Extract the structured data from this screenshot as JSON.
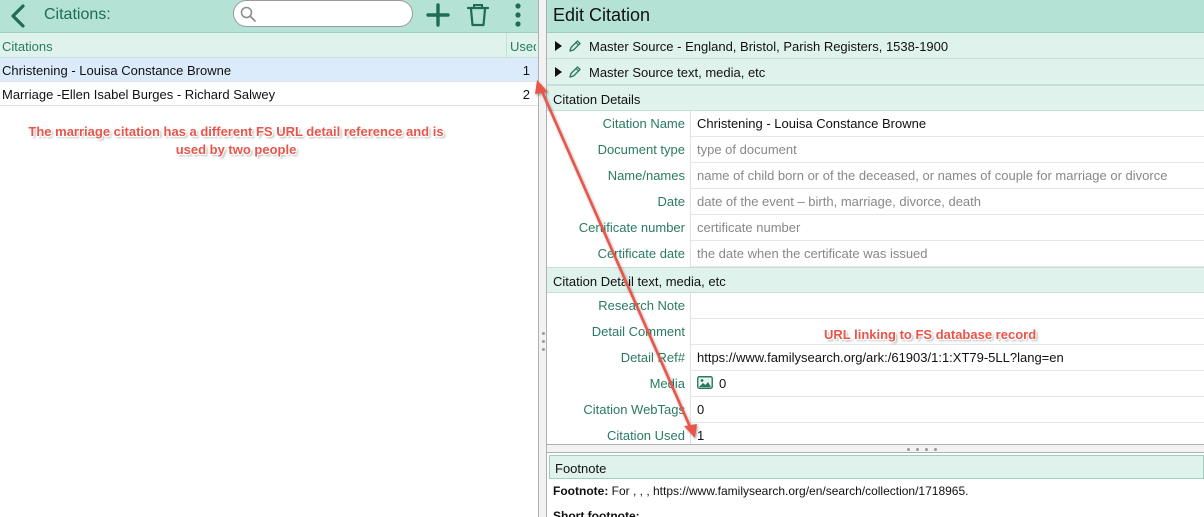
{
  "left": {
    "title": "Citations:",
    "search": {
      "value": "",
      "placeholder": ""
    },
    "columns": {
      "name": "Citations",
      "used": "Used"
    },
    "rows": [
      {
        "name": "Christening - Louisa Constance Browne",
        "used": "1"
      },
      {
        "name": "Marriage -Ellen Isabel Burges - Richard Salwey",
        "used": "2"
      }
    ],
    "annotation": "The marriage citation has a different FS URL detail reference and is used by two people"
  },
  "right": {
    "title": "Edit Citation",
    "master_source": "Master Source - England, Bristol, Parish Registers, 1538-1900",
    "master_source_text": "Master Source text, media, etc",
    "citation_details_header": "Citation Details",
    "fields": {
      "citation_name": {
        "label": "Citation Name",
        "value": "Christening - Louisa Constance Browne"
      },
      "document_type": {
        "label": "Document type",
        "placeholder": "type of document"
      },
      "names": {
        "label": "Name/names",
        "placeholder": "name of child born or of the deceased, or names of couple for marriage or divorce"
      },
      "date": {
        "label": "Date",
        "placeholder": "date of the event – birth, marriage, divorce, death"
      },
      "certificate_number": {
        "label": "Certificate number",
        "placeholder": "certificate number"
      },
      "certificate_date": {
        "label": "Certificate date",
        "placeholder": "the date when the certificate was issued"
      }
    },
    "detail_header": "Citation Detail text, media, etc",
    "detail_fields": {
      "research_note": {
        "label": "Research Note",
        "value": ""
      },
      "detail_comment": {
        "label": "Detail Comment",
        "value": ""
      },
      "detail_ref": {
        "label": "Detail Ref#",
        "value": "https://www.familysearch.org/ark:/61903/1:1:XT79-5LL?lang=en"
      },
      "media": {
        "label": "Media",
        "value": "0"
      },
      "webtags": {
        "label": "Citation WebTags",
        "value": "0"
      },
      "citation_used": {
        "label": "Citation Used",
        "value": "1"
      }
    },
    "url_annotation": "URL linking to FS database record",
    "footnote_header": "Footnote",
    "footnote_label": "Footnote:",
    "footnote_text": " For , , , https://www.familysearch.org/en/search/collection/1718965.",
    "short_footnote_label": "Short footnote:"
  },
  "colors": {
    "toolbar": "#b4e3d5",
    "header": "#dff2ec",
    "accent": "#2a7a63",
    "annotation": "#e9554a",
    "selected_row": "#dcebfb"
  },
  "icons": [
    "back-chevron-icon",
    "search-icon",
    "add-icon",
    "trash-icon",
    "more-vertical-icon",
    "disclosure-triangle-icon",
    "pencil-icon",
    "media-image-icon"
  ]
}
